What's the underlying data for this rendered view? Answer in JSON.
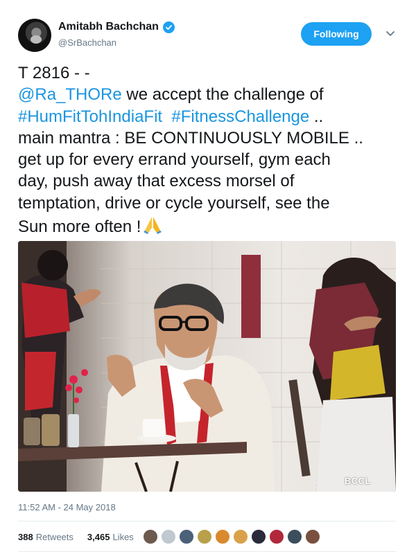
{
  "author": {
    "name": "Amitabh Bachchan",
    "handle": "@SrBachchan",
    "follow_button": "Following"
  },
  "tweet": {
    "line1": "T 2816 - -",
    "mention": "@Ra_THORe",
    "line2_rest": " we accept the challenge of",
    "hashtag1": "#HumFitTohIndiaFit",
    "hashtag2": "#FitnessChallenge",
    "line3_rest": " ..",
    "line4": "main mantra : BE CONTINUOUSLY MOBILE ..",
    "line5": "get up for every errand yourself, gym each",
    "line6": "day, push away that excess morsel of",
    "line7": "temptation, drive or cycle yourself, see the",
    "line8": "Sun more often !"
  },
  "photo": {
    "watermark": "BCCL"
  },
  "timestamp": "11:52 AM - 24 May 2018",
  "stats": {
    "retweets_count": "388",
    "retweets_label": "Retweets",
    "likes_count": "3,465",
    "likes_label": "Likes"
  },
  "colors": {
    "accent": "#1da1f2",
    "link": "#1b95e0",
    "muted": "#657786"
  },
  "icons": [
    "verified-badge-icon",
    "chevron-down-icon",
    "folded-hands-emoji"
  ]
}
